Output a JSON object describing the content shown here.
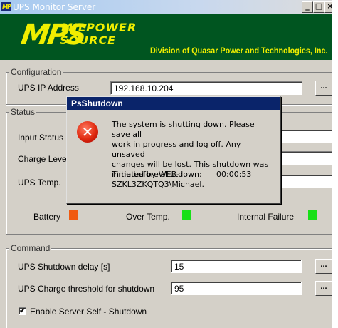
{
  "window": {
    "title": "UPS Monitor Server",
    "icon_text": "MP",
    "controls": [
      "_",
      "□",
      "×"
    ]
  },
  "banner": {
    "logo_letters": "MPS",
    "logo_line1": "MILPOWER",
    "logo_line2": "SOURCE",
    "division": "Division of Quasar Power and Technologies, Inc."
  },
  "configuration": {
    "legend": "Configuration",
    "ip_label": "UPS IP Address",
    "ip_value": "192.168.10.204",
    "browse_label": "..."
  },
  "status": {
    "legend": "Status",
    "input_status_label": "Input Status",
    "charge_level_label": "Charge Leve",
    "ups_temp_label": "UPS Temp.",
    "battery_label": "Battery",
    "over_temp_label": "Over Temp.",
    "internal_failure_label": "Internal Failure",
    "colors": {
      "battery": "#f05a10",
      "over_temp": "#18e018",
      "internal_failure": "#18e018"
    }
  },
  "command": {
    "legend": "Command",
    "shutdown_delay_label": "UPS Shutdown delay [s]",
    "shutdown_delay_value": "15",
    "charge_threshold_label": "UPS Charge threshold for shutdown",
    "charge_threshold_value": "95",
    "browse_label": "...",
    "self_shutdown_label": "Enable Server Self - Shutdown",
    "self_shutdown_checked": true,
    "check_mark": "✔"
  },
  "dialog": {
    "title": "PsShutdown",
    "error_glyph": "✕",
    "message_lines": [
      "The system is shutting down. Please save all",
      "work in progress and log off. Any unsaved",
      "changes will be lost. This shutdown was",
      "initiated by WEB-SZKL3ZKQTQ3\\Michael."
    ],
    "time_label": "Time before shutdown:",
    "time_value": "00:00:53"
  }
}
